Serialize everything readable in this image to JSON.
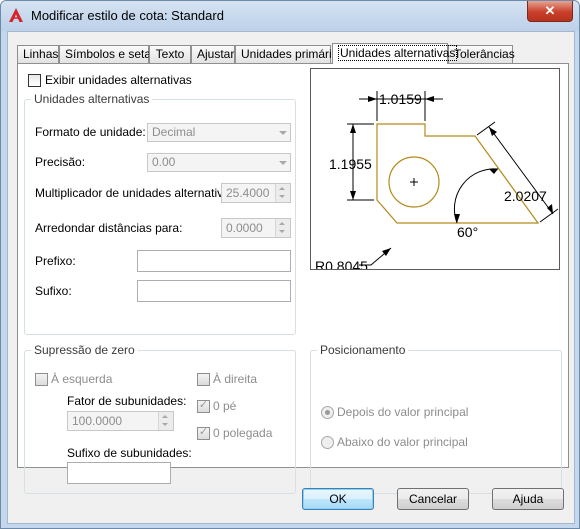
{
  "window": {
    "title": "Modificar estilo de cota: Standard",
    "close_label": "✕"
  },
  "tabs": [
    {
      "label": "Linhas"
    },
    {
      "label": "Símbolos e setas"
    },
    {
      "label": "Texto"
    },
    {
      "label": "Ajustar"
    },
    {
      "label": "Unidades primárias"
    },
    {
      "label": "Unidades alternativas",
      "active": true
    },
    {
      "label": "Tolerâncias"
    }
  ],
  "show_alt": {
    "label": "Exibir unidades alternativas",
    "checked": false
  },
  "alt_units": {
    "title": "Unidades alternativas",
    "format_label": "Formato de unidade:",
    "format_value": "Decimal",
    "precision_label": "Precisão:",
    "precision_value": "0.00",
    "multiplier_label": "Multiplicador de unidades alternativas:",
    "multiplier_value": "25.4000",
    "round_label": "Arredondar distâncias para:",
    "round_value": "0.0000",
    "prefix_label": "Prefixo:",
    "prefix_value": "",
    "suffix_label": "Sufixo:",
    "suffix_value": ""
  },
  "zero_suppression": {
    "title": "Supressão de zero",
    "leading_label": "À esquerda",
    "subunit_factor_label": "Fator de subunidades:",
    "subunit_factor_value": "100.0000",
    "subunit_suffix_label": "Sufixo de subunidades:",
    "subunit_suffix_value": "",
    "trailing_label": "À direita",
    "zero_feet_label": "0 pé",
    "zero_feet_checked": true,
    "zero_inches_label": "0 polegada",
    "zero_inches_checked": true
  },
  "placement": {
    "title": "Posicionamento",
    "after_label": "Depois do valor principal",
    "after_selected": true,
    "below_label": "Abaixo do valor principal"
  },
  "preview": {
    "dim_top": "1.0159",
    "dim_left": "1.1955",
    "dim_right": "2.0207",
    "dim_angle": "60°",
    "dim_radius": "R0.8045"
  },
  "buttons": {
    "ok": "OK",
    "cancel": "Cancelar",
    "help": "Ajuda"
  }
}
